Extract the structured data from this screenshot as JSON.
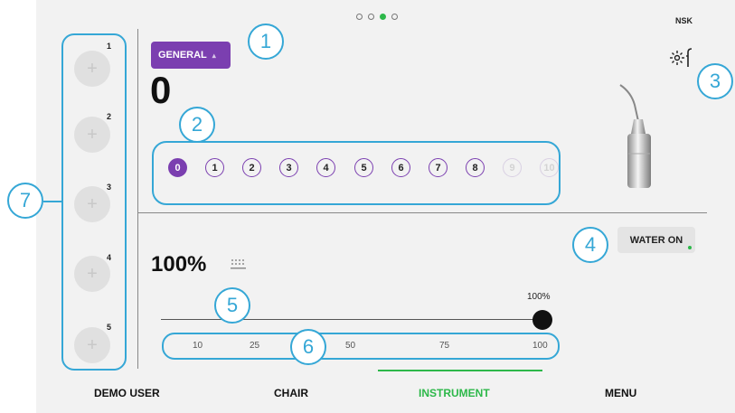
{
  "header": {
    "page_dots": [
      false,
      false,
      true,
      false
    ],
    "brand": "NSK"
  },
  "presets": [
    {
      "number": "1",
      "symbol": "+"
    },
    {
      "number": "2",
      "symbol": "+"
    },
    {
      "number": "3",
      "symbol": "+"
    },
    {
      "number": "4",
      "symbol": "+"
    },
    {
      "number": "5",
      "symbol": "+"
    }
  ],
  "mode": {
    "label": "GENERAL",
    "power_value": "0"
  },
  "power_levels": {
    "items": [
      "0",
      "1",
      "2",
      "3",
      "4",
      "5",
      "6",
      "7",
      "8",
      "9",
      "10"
    ],
    "selected": "0",
    "disabled": [
      "9",
      "10"
    ]
  },
  "water": {
    "button_label": "WATER ON",
    "flow_percent": "100%",
    "slider_value_label": "100%",
    "slider_fraction": 1.0,
    "scale_ticks": [
      "10",
      "25",
      "50",
      "75",
      "100"
    ]
  },
  "callouts": [
    "1",
    "2",
    "3",
    "4",
    "5",
    "6",
    "7"
  ],
  "nav": {
    "items": [
      "DEMO USER",
      "CHAIR",
      "INSTRUMENT",
      "MENU"
    ],
    "active": "INSTRUMENT"
  },
  "colors": {
    "accent_purple": "#7b3fb0",
    "accent_green": "#2db84a",
    "callout_blue": "#35a7d6"
  }
}
